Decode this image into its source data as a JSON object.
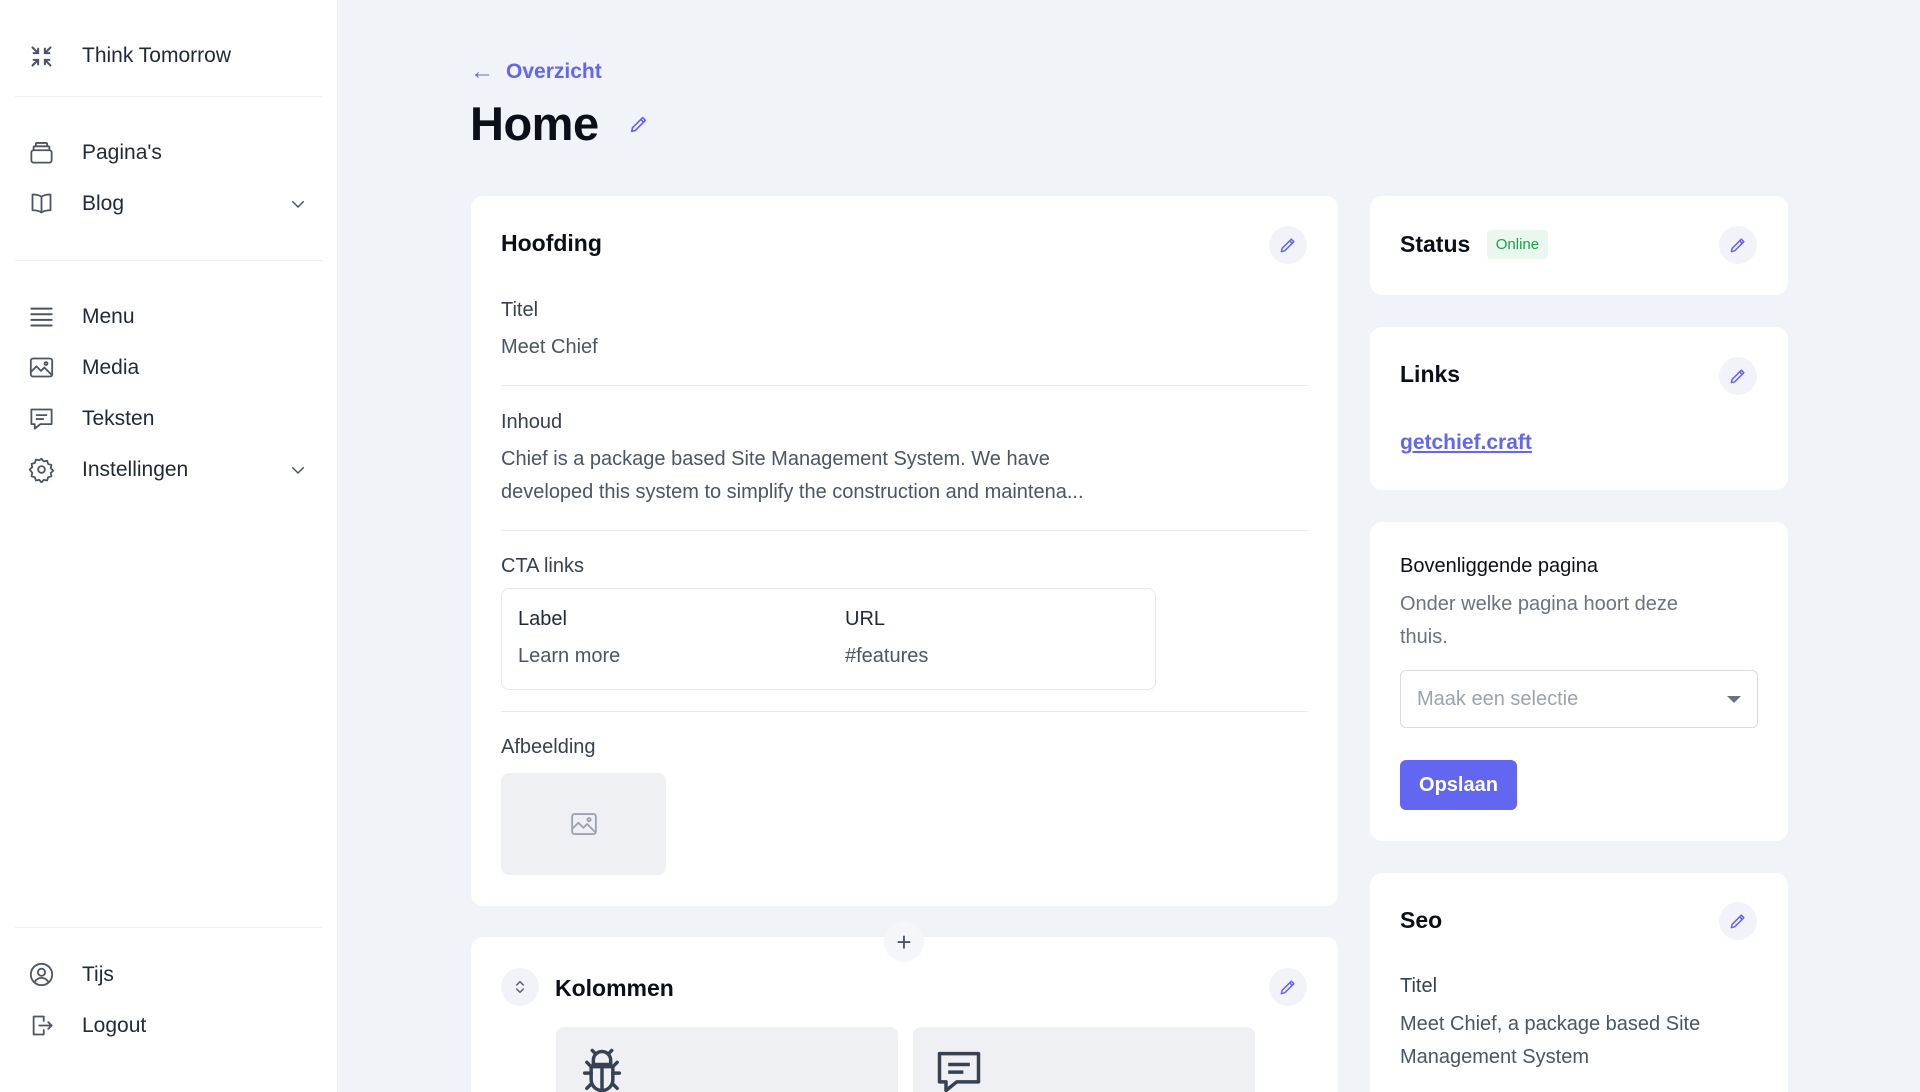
{
  "sidebar": {
    "brand": "Think Tomorrow",
    "items_top": [
      {
        "label": "Pagina's",
        "icon": "stack-icon"
      },
      {
        "label": "Blog",
        "icon": "book-icon",
        "has_submenu": true
      }
    ],
    "items_mid": [
      {
        "label": "Menu",
        "icon": "lines-icon"
      },
      {
        "label": "Media",
        "icon": "image-icon"
      },
      {
        "label": "Teksten",
        "icon": "chat-icon"
      },
      {
        "label": "Instellingen",
        "icon": "gear-icon",
        "has_submenu": true
      }
    ],
    "items_bottom": [
      {
        "label": "Tijs",
        "icon": "user-icon"
      },
      {
        "label": "Logout",
        "icon": "logout-icon"
      }
    ]
  },
  "header": {
    "back_label": "Overzicht",
    "title": "Home"
  },
  "hoofding": {
    "title": "Hoofding",
    "titel_label": "Titel",
    "titel_value": "Meet Chief",
    "inhoud_label": "Inhoud",
    "inhoud_line1": "Chief is a package based Site Management System. We have",
    "inhoud_line2": "developed this system to simplify the construction and maintena...",
    "cta_label": "CTA links",
    "cta_columns": [
      "Label",
      "URL"
    ],
    "cta_rows": [
      [
        "Learn more",
        "#features"
      ]
    ],
    "afbeelding_label": "Afbeelding"
  },
  "kolommen": {
    "title": "Kolommen"
  },
  "status": {
    "title": "Status",
    "badge": "Online"
  },
  "links": {
    "title": "Links",
    "url": "getchief.craft"
  },
  "parent": {
    "title": "Bovenliggende pagina",
    "help_line1": "Onder welke pagina hoort deze",
    "help_line2": "thuis.",
    "select_placeholder": "Maak een selectie",
    "save_label": "Opslaan"
  },
  "seo": {
    "title": "Seo",
    "titel_label": "Titel",
    "titel_line1": "Meet Chief, a package based Site",
    "titel_line2": "Management System"
  },
  "colors": {
    "accent": "#6366f1",
    "online": "#16a34a",
    "background": "#f0f3f8"
  }
}
